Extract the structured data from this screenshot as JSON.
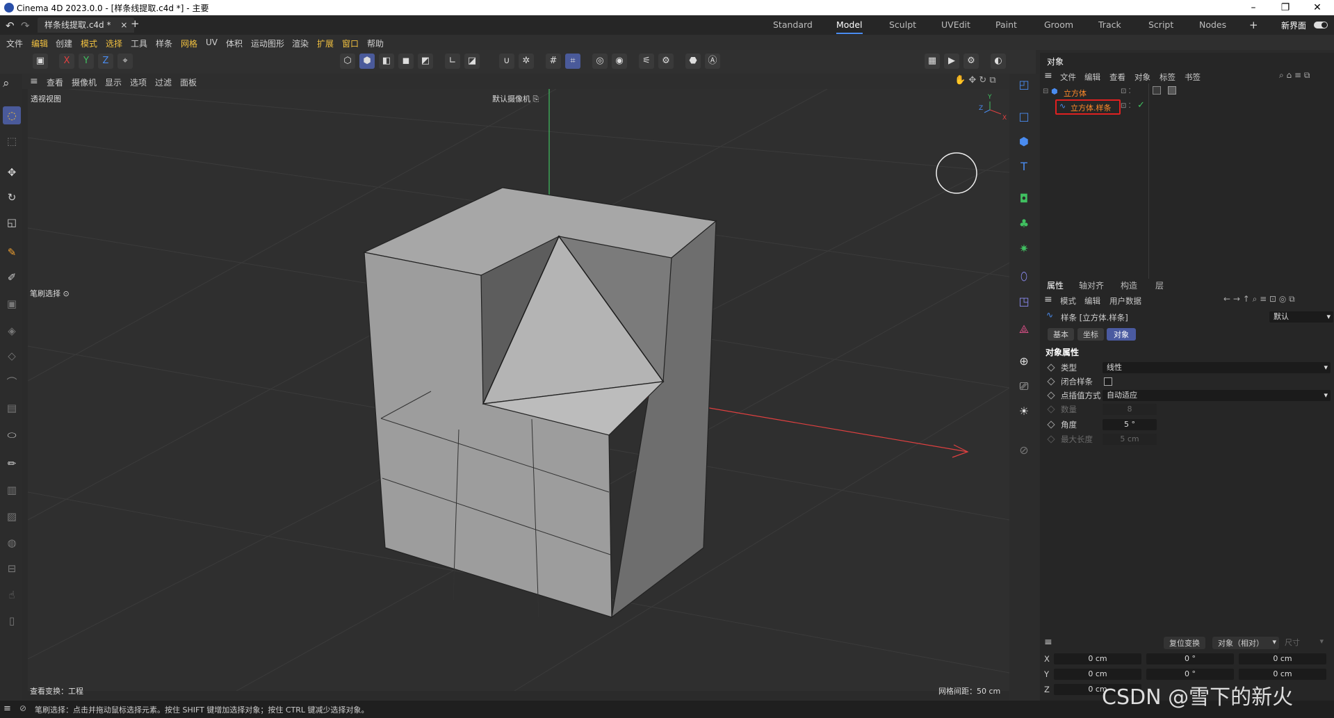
{
  "window": {
    "title": "Cinema 4D 2023.0.0 - [样条线提取.c4d *] - 主要",
    "minimize": "–",
    "restore": "❐",
    "close": "✕"
  },
  "tabs": {
    "doc": "样条线提取.c4d *",
    "doc_close": "×",
    "add": "+",
    "layouts": [
      "Standard",
      "Model",
      "Sculpt",
      "UVEdit",
      "Paint",
      "Groom",
      "Track",
      "Script",
      "Nodes"
    ],
    "active_layout": "Model",
    "new_interface": "新界面",
    "plus": "+"
  },
  "menu": [
    "文件",
    "编辑",
    "创建",
    "模式",
    "选择",
    "工具",
    "样条",
    "网格",
    "UV",
    "体积",
    "运动图形",
    "渲染",
    "扩展",
    "窗口",
    "帮助"
  ],
  "toolbar": {
    "axis_x": "X",
    "axis_y": "Y",
    "axis_z": "Z"
  },
  "viewport": {
    "menu": [
      "查看",
      "摄像机",
      "显示",
      "选项",
      "过滤",
      "面板"
    ],
    "view_name": "透视视图",
    "camera": "默认摄像机",
    "brush_tip": "笔刷选择",
    "transform": "查看变换：工程",
    "grid_spacing": "网格间距：50 cm",
    "gizmo_y": "Y",
    "gizmo_z": "Z",
    "gizmo_x": "X"
  },
  "object_manager": {
    "title": "对象",
    "menu": [
      "文件",
      "编辑",
      "查看",
      "对象",
      "标签",
      "书签"
    ],
    "objects": [
      {
        "name": "立方体"
      },
      {
        "name": "立方体.样条"
      }
    ]
  },
  "attributes": {
    "tabs": [
      "属性",
      "轴对齐",
      "构造",
      "层"
    ],
    "menu": [
      "模式",
      "编辑",
      "用户数据"
    ],
    "object_title": "样条 [立方体.样条]",
    "preset": "默认",
    "subtabs": [
      "基本",
      "坐标",
      "对象"
    ],
    "active_subtab": "对象",
    "section": "对象属性",
    "props": {
      "type_label": "类型",
      "type_value": "线性",
      "close_label": "闭合样条",
      "interp_label": "点插值方式",
      "interp_value": "自动适应",
      "count_label": "数量",
      "count_value": "8",
      "angle_label": "角度",
      "angle_value": "5 °",
      "maxlen_label": "最大长度",
      "maxlen_value": "5 cm"
    }
  },
  "coords": {
    "reset": "复位变换",
    "mode": "对象（相对）",
    "size": "尺寸",
    "rows": [
      {
        "axis": "X",
        "pos": "0 cm",
        "rot": "0 °",
        "size": "0 cm"
      },
      {
        "axis": "Y",
        "pos": "0 cm",
        "rot": "0 °",
        "size": "0 cm"
      },
      {
        "axis": "Z",
        "pos": "0 cm"
      }
    ]
  },
  "status": {
    "text": "笔刷选择：点击并拖动鼠标选择元素。按住 SHIFT 键增加选择对象；按住 CTRL 键减少选择对象。"
  },
  "watermark": "CSDN @雪下的新火",
  "colors": {
    "accent": "#4a8cf0",
    "highlight_box": "#e02020",
    "selected_object": "#ff8a2a",
    "axis_x": "#e04040",
    "axis_y": "#40c060",
    "axis_z": "#4a8cf0"
  }
}
